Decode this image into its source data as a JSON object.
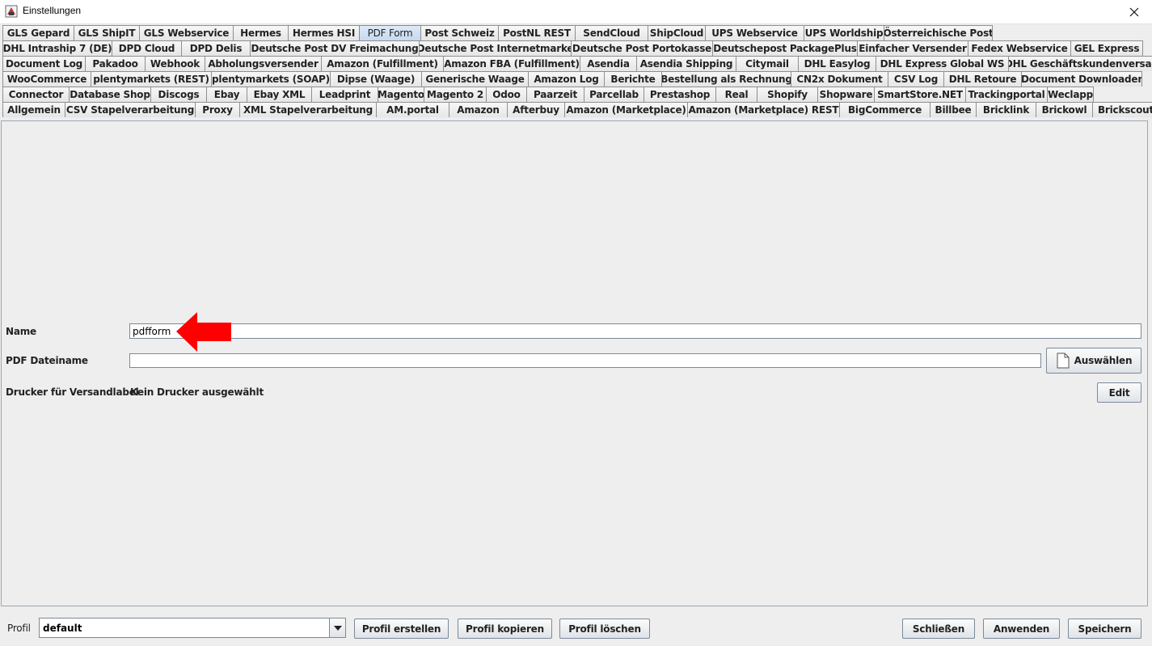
{
  "window": {
    "title": "Einstellungen"
  },
  "tabs": {
    "rows": [
      [
        "GLS Gepard",
        "GLS ShipIT",
        "GLS Webservice",
        "Hermes",
        "Hermes HSI",
        "PDF Form",
        "Post Schweiz",
        "PostNL REST",
        "SendCloud",
        "ShipCloud",
        "UPS Webservice",
        "UPS Worldship",
        "Österreichische Post"
      ],
      [
        "DHL Intraship 7 (DE)",
        "DPD Cloud",
        "DPD Delis",
        "Deutsche Post DV Freimachung",
        "Deutsche Post Internetmarke",
        "Deutsche Post Portokasse",
        "Deutschepost PackagePlus",
        "Einfacher Versender",
        "Fedex Webservice",
        "GEL Express"
      ],
      [
        "Document Log",
        "Pakadoo",
        "Webhook",
        "Abholungsversender",
        "Amazon (Fulfillment)",
        "Amazon FBA (Fulfillment)",
        "Asendia",
        "Asendia Shipping",
        "Citymail",
        "DHL Easylog",
        "DHL Express Global WS",
        "DHL Geschäftskundenversand"
      ],
      [
        "WooCommerce",
        "plentymarkets (REST)",
        "plentymarkets (SOAP)",
        "Dipse (Waage)",
        "Generische Waage",
        "Amazon Log",
        "Berichte",
        "Bestellung als Rechnung",
        "CN2x Dokument",
        "CSV Log",
        "DHL Retoure",
        "Document Downloader"
      ],
      [
        "Connector",
        "Database Shop",
        "Discogs",
        "Ebay",
        "Ebay XML",
        "Leadprint",
        "Magento",
        "Magento 2",
        "Odoo",
        "Paarzeit",
        "Parcellab",
        "Prestashop",
        "Real",
        "Shopify",
        "Shopware",
        "SmartStore.NET",
        "Trackingportal",
        "Weclapp"
      ],
      [
        "Allgemein",
        "CSV Stapelverarbeitung",
        "Proxy",
        "XML Stapelverarbeitung",
        "AM.portal",
        "Amazon",
        "Afterbuy",
        "Amazon (Marketplace)",
        "Amazon (Marketplace) REST",
        "BigCommerce",
        "Billbee",
        "Bricklink",
        "Brickowl",
        "Brickscout"
      ]
    ],
    "selected": "PDF Form"
  },
  "form": {
    "name_label": "Name",
    "name_value": "pdfform",
    "pdf_label": "PDF Dateiname",
    "pdf_value": "",
    "select_button": "Auswählen",
    "printer_label": "Drucker für Versandlabel",
    "printer_value": "Kein Drucker ausgewählt",
    "edit_button": "Edit"
  },
  "footer": {
    "profile_label": "Profil",
    "profile_value": "default",
    "create_button": "Profil erstellen",
    "copy_button": "Profil kopieren",
    "delete_button": "Profil löschen",
    "close_button": "Schließen",
    "apply_button": "Anwenden",
    "save_button": "Speichern"
  },
  "colors": {
    "arrow": "#ff0000",
    "selected_tab": "#c6d9f0"
  },
  "icons": {
    "app": "app-icon",
    "close": "close-icon",
    "file": "file-icon",
    "dropdown": "chevron-down-icon",
    "annotation": "red-arrow-icon"
  }
}
